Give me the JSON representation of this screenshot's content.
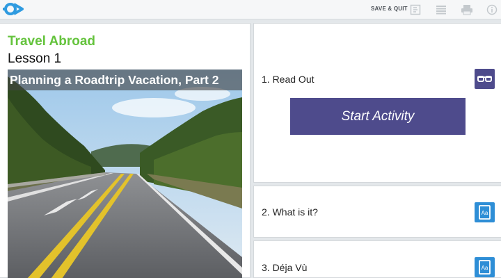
{
  "header": {
    "logo": "app-logo",
    "save_quit": "SAVE & QUIT",
    "icons": [
      "transcript-icon",
      "menu-list-icon",
      "print-icon",
      "info-icon"
    ]
  },
  "lesson": {
    "course_title": "Travel Abroad",
    "lesson_label": "Lesson 1",
    "photo_caption": "Planning a Roadtrip Vacation, Part 2"
  },
  "activities": [
    {
      "label": "1. Read Out",
      "icon": "glasses-icon",
      "button_label": "Start Activity"
    },
    {
      "label": "2. What is it?",
      "icon": "dictionary-icon"
    },
    {
      "label": "3. Déja Vù",
      "icon": "dictionary-icon"
    }
  ],
  "colors": {
    "accent_green": "#64c33c",
    "brand_purple": "#4e4b8c",
    "icon_blue": "#2e8ed6",
    "logo_blue": "#2f9be0"
  }
}
